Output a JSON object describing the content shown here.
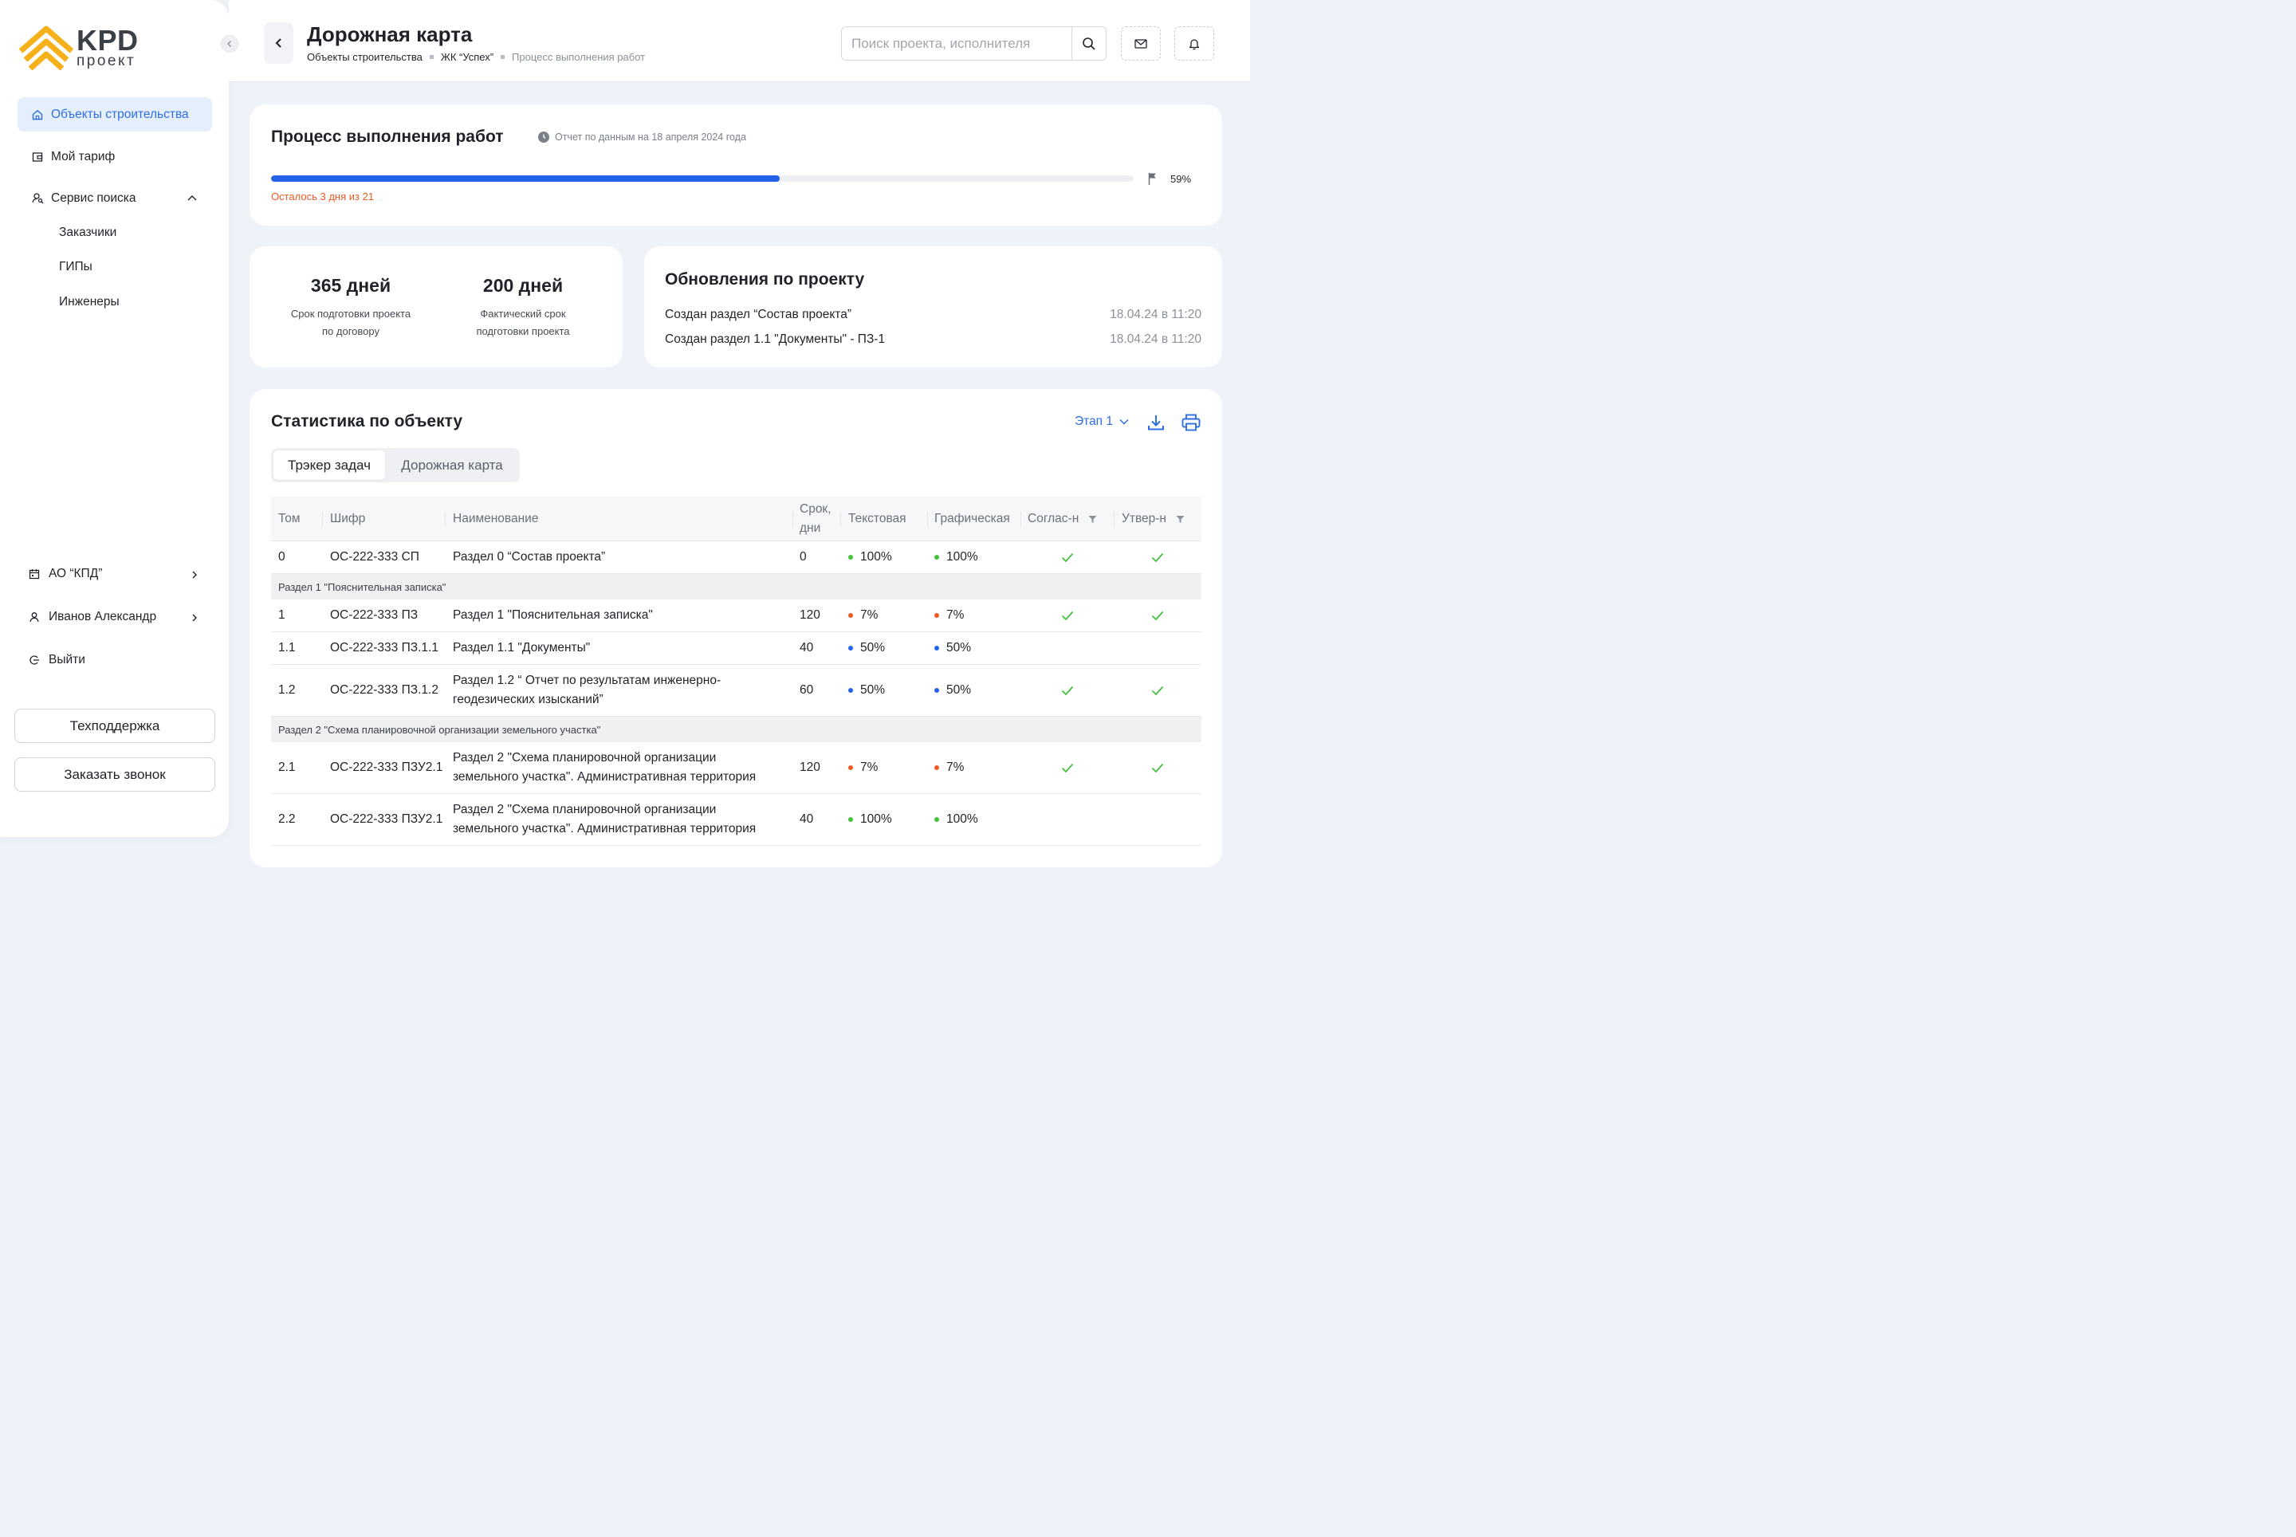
{
  "brand": {
    "name": "KPD",
    "subname": "проект"
  },
  "sidebar": {
    "nav": [
      {
        "label": "Объекты строительства",
        "icon": "home-icon",
        "active": true
      },
      {
        "label": "Мой тариф",
        "icon": "wallet-icon"
      },
      {
        "label": "Сервис поиска",
        "icon": "search-people-icon",
        "expanded": true
      }
    ],
    "sub_items": [
      "Заказчики",
      "ГИПы",
      "Инженеры"
    ],
    "organization": "АО “КПД”",
    "user": "Иванов Александр",
    "logout": "Выйти",
    "support_button": "Техподдержка",
    "callback_button": "Заказать звонок"
  },
  "header": {
    "title": "Дорожная карта",
    "breadcrumbs": [
      "Объекты строительства",
      "ЖК “Успех”",
      "Процесс выполнения работ"
    ],
    "search_placeholder": "Поиск проекта, исполнителя"
  },
  "progress": {
    "title": "Процесс выполнения работ",
    "report_note": "Отчет по данным на 18 апреля 2024 года",
    "percent": 59,
    "percent_label": "59%",
    "remaining": "Осталось 3 дня из 21"
  },
  "stats": [
    {
      "value": "365 дней",
      "label_line1": "Срок подготовки проекта",
      "label_line2": "по договору"
    },
    {
      "value": "200 дней",
      "label_line1": "Фактический срок",
      "label_line2": "подготовки проекта"
    }
  ],
  "updates": {
    "title": "Обновления по проекту",
    "items": [
      {
        "text": "Создан раздел “Состав проекта”",
        "time": "18.04.24 в 11:20"
      },
      {
        "text": "Создан раздел  1.1 \"Документы\" - ПЗ-1",
        "time": "18.04.24 в 11:20"
      }
    ]
  },
  "statistics": {
    "title": "Статистика по объекту",
    "stage": "Этап 1",
    "tabs": [
      {
        "label": "Трэкер задач",
        "active": true
      },
      {
        "label": "Дорожная карта",
        "active": false
      }
    ],
    "columns": {
      "tom": "Том",
      "cipher": "Шифр",
      "name": "Наименование",
      "term_line1": "Срок,",
      "term_line2": "дни",
      "text": "Текстовая",
      "graphic": "Графическая",
      "approve1": "Соглас-н",
      "approve2": "Утвер-н"
    },
    "status_colors": {
      "green": "#45c23d",
      "orange": "#ee5a24",
      "blue": "#2362e8"
    },
    "rows": [
      {
        "tom": "0",
        "cipher": "ОС-222-333 СП",
        "name1": "Раздел 0 “Состав проекта”",
        "name2": "",
        "term": "0",
        "text": "100%",
        "text_status": "green",
        "graphic": "100%",
        "graphic_status": "green",
        "agreed": true,
        "approved": true
      },
      {
        "group": "Раздел 1 \"Пояснительная записка\""
      },
      {
        "tom": "1",
        "cipher": "ОС-222-333 ПЗ",
        "name1": "Раздел 1 \"Пояснительная записка\"",
        "name2": "",
        "term": "120",
        "text": "7%",
        "text_status": "orange",
        "graphic": "7%",
        "graphic_status": "orange",
        "agreed": true,
        "approved": true
      },
      {
        "tom": "1.1",
        "cipher": "ОС-222-333 ПЗ.1.1",
        "name1": "Раздел 1.1 \"Документы\"",
        "name2": "",
        "term": "40",
        "text": "50%",
        "text_status": "blue",
        "graphic": "50%",
        "graphic_status": "blue",
        "agreed": false,
        "approved": false
      },
      {
        "tom": "1.2",
        "cipher": "ОС-222-333 ПЗ.1.2",
        "name1": "Раздел 1.2 “ Отчет по результатам инженерно-",
        "name2": "геодезических изысканий”",
        "term": "60",
        "text": "50%",
        "text_status": "blue",
        "graphic": "50%",
        "graphic_status": "blue",
        "agreed": true,
        "approved": true
      },
      {
        "group": "Раздел 2 \"Схема планировочной организации земельного участка\""
      },
      {
        "tom": "2.1",
        "cipher": "ОС-222-333 ПЗУ2.1",
        "name1": "Раздел 2 \"Схема планировочной организации",
        "name2": "земельного участка\". Административная территория",
        "term": "120",
        "text": "7%",
        "text_status": "orange",
        "graphic": "7%",
        "graphic_status": "orange",
        "agreed": true,
        "approved": true
      },
      {
        "tom": "2.2",
        "cipher": "ОС-222-333 ПЗУ2.1",
        "name1": "Раздел 2 \"Схема планировочной организации",
        "name2": "земельного участка\". Административная территория",
        "term": "40",
        "text": "100%",
        "text_status": "green",
        "graphic": "100%",
        "graphic_status": "green",
        "agreed": false,
        "approved": false
      }
    ]
  }
}
